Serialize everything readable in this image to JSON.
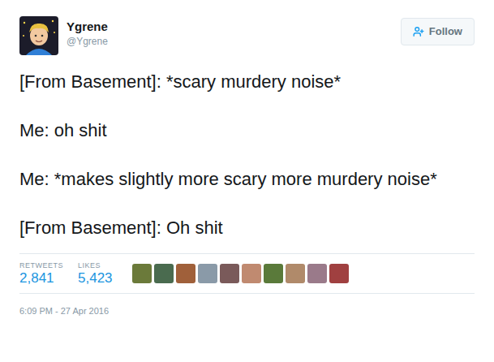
{
  "user": {
    "name": "Ygrene",
    "handle": "@Ygrene"
  },
  "follow_button": {
    "label": "Follow"
  },
  "tweet": {
    "paragraphs": [
      "[From Basement]: *scary murdery noise*",
      "Me: oh shit",
      "Me: *makes slightly more scary more murdery noise*",
      "[From Basement]: Oh shit"
    ]
  },
  "stats": [
    {
      "label": "RETWEETS",
      "value": "2,841"
    },
    {
      "label": "LIKES",
      "value": "5,423"
    }
  ],
  "liker_avatars": [
    {
      "color": "#6b7a3a"
    },
    {
      "color": "#4a6b4f"
    },
    {
      "color": "#a0603a"
    },
    {
      "color": "#8a9aa8"
    },
    {
      "color": "#7a5a5a"
    },
    {
      "color": "#c08a70"
    },
    {
      "color": "#5a7a3a"
    },
    {
      "color": "#b08a6a"
    },
    {
      "color": "#9a7a8a"
    },
    {
      "color": "#a04040"
    }
  ],
  "timestamp": "6:09 PM - 27 Apr 2016"
}
